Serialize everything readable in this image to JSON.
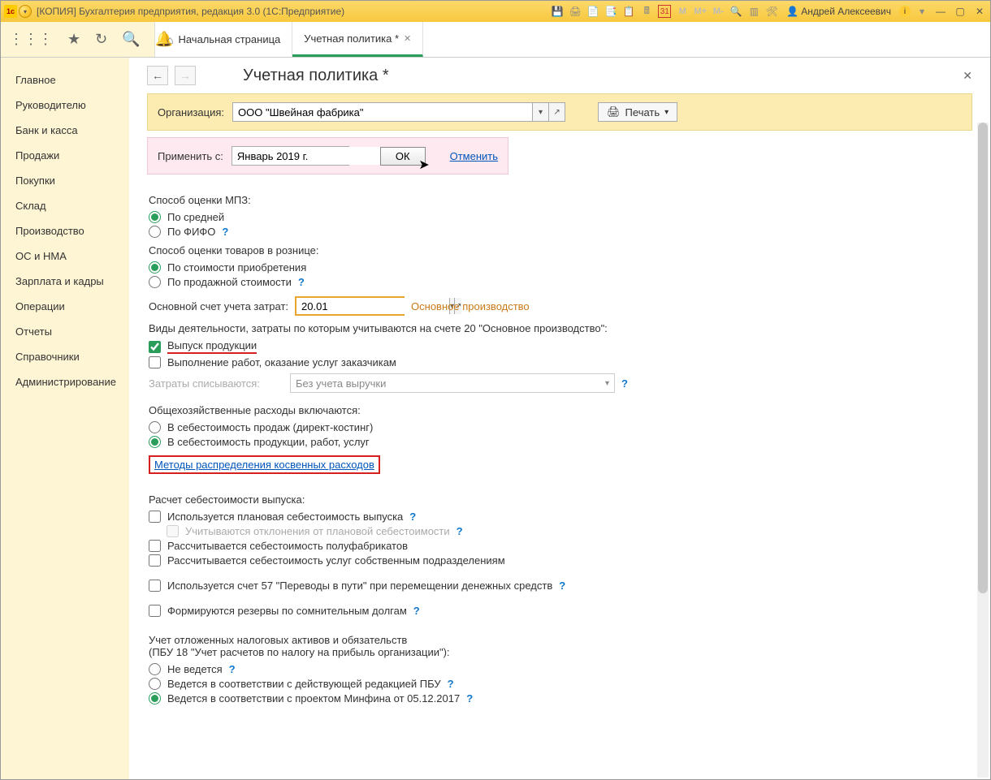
{
  "titlebar": {
    "title": "[КОПИЯ] Бухгалтерия предприятия, редакция 3.0  (1С:Предприятие)",
    "user": "Андрей Алексеевич",
    "m_labels": [
      "M",
      "M+",
      "M-"
    ],
    "cal_day": "31"
  },
  "toolbar": {
    "tabs": [
      {
        "label": "Начальная страница",
        "home": true,
        "active": false,
        "closable": false
      },
      {
        "label": "Учетная политика *",
        "home": false,
        "active": true,
        "closable": true
      }
    ]
  },
  "sidebar": {
    "items": [
      "Главное",
      "Руководителю",
      "Банк и касса",
      "Продажи",
      "Покупки",
      "Склад",
      "Производство",
      "ОС и НМА",
      "Зарплата и кадры",
      "Операции",
      "Отчеты",
      "Справочники",
      "Администрирование"
    ]
  },
  "page": {
    "title": "Учетная политика *"
  },
  "org_panel": {
    "label": "Организация:",
    "value": "ООО \"Швейная фабрика\"",
    "print_label": "Печать"
  },
  "apply_panel": {
    "label": "Применить с:",
    "value": "Январь 2019 г.",
    "ok": "ОК",
    "cancel": "Отменить"
  },
  "form": {
    "mpz_label": "Способ оценки МПЗ:",
    "mpz_opt1": "По средней",
    "mpz_opt2": "По ФИФО",
    "retail_label": "Способ оценки товаров в рознице:",
    "retail_opt1": "По стоимости приобретения",
    "retail_opt2": "По продажной стоимости",
    "account_label": "Основной счет учета затрат:",
    "account_value": "20.01",
    "account_hint": "Основное производство",
    "activities_label": "Виды деятельности, затраты по которым учитываются на счете 20 \"Основное производство\":",
    "act_chk1": "Выпуск продукции",
    "act_chk2": "Выполнение работ, оказание услуг заказчикам",
    "writeoff_label": "Затраты списываются:",
    "writeoff_value": "Без учета выручки",
    "overhead_label": "Общехозяйственные расходы включаются:",
    "overhead_opt1": "В себестоимость продаж (директ-костинг)",
    "overhead_opt2": "В  себестоимость продукции, работ, услуг",
    "indirect_link": "Методы распределения косвенных расходов",
    "cost_calc_label": "Расчет себестоимости выпуска:",
    "cost_chk1": "Используется плановая себестоимость выпуска",
    "cost_chk1a": "Учитываются отклонения от плановой себестоимости",
    "cost_chk2": "Рассчитывается себестоимость полуфабрикатов",
    "cost_chk3": "Рассчитывается себестоимость услуг собственным подразделениям",
    "acc57_chk": "Используется счет 57 \"Переводы в пути\" при перемещении денежных средств",
    "reserve_chk": "Формируются резервы по сомнительным долгам",
    "deferred_line1": "Учет отложенных налоговых активов и обязательств",
    "deferred_line2": "(ПБУ 18 \"Учет расчетов по налогу на прибыль организации\"):",
    "def_opt1": "Не ведется",
    "def_opt2": "Ведется в соответствии с действующей редакцией ПБУ",
    "def_opt3": "Ведется в соответствии с проектом Минфина от 05.12.2017"
  }
}
